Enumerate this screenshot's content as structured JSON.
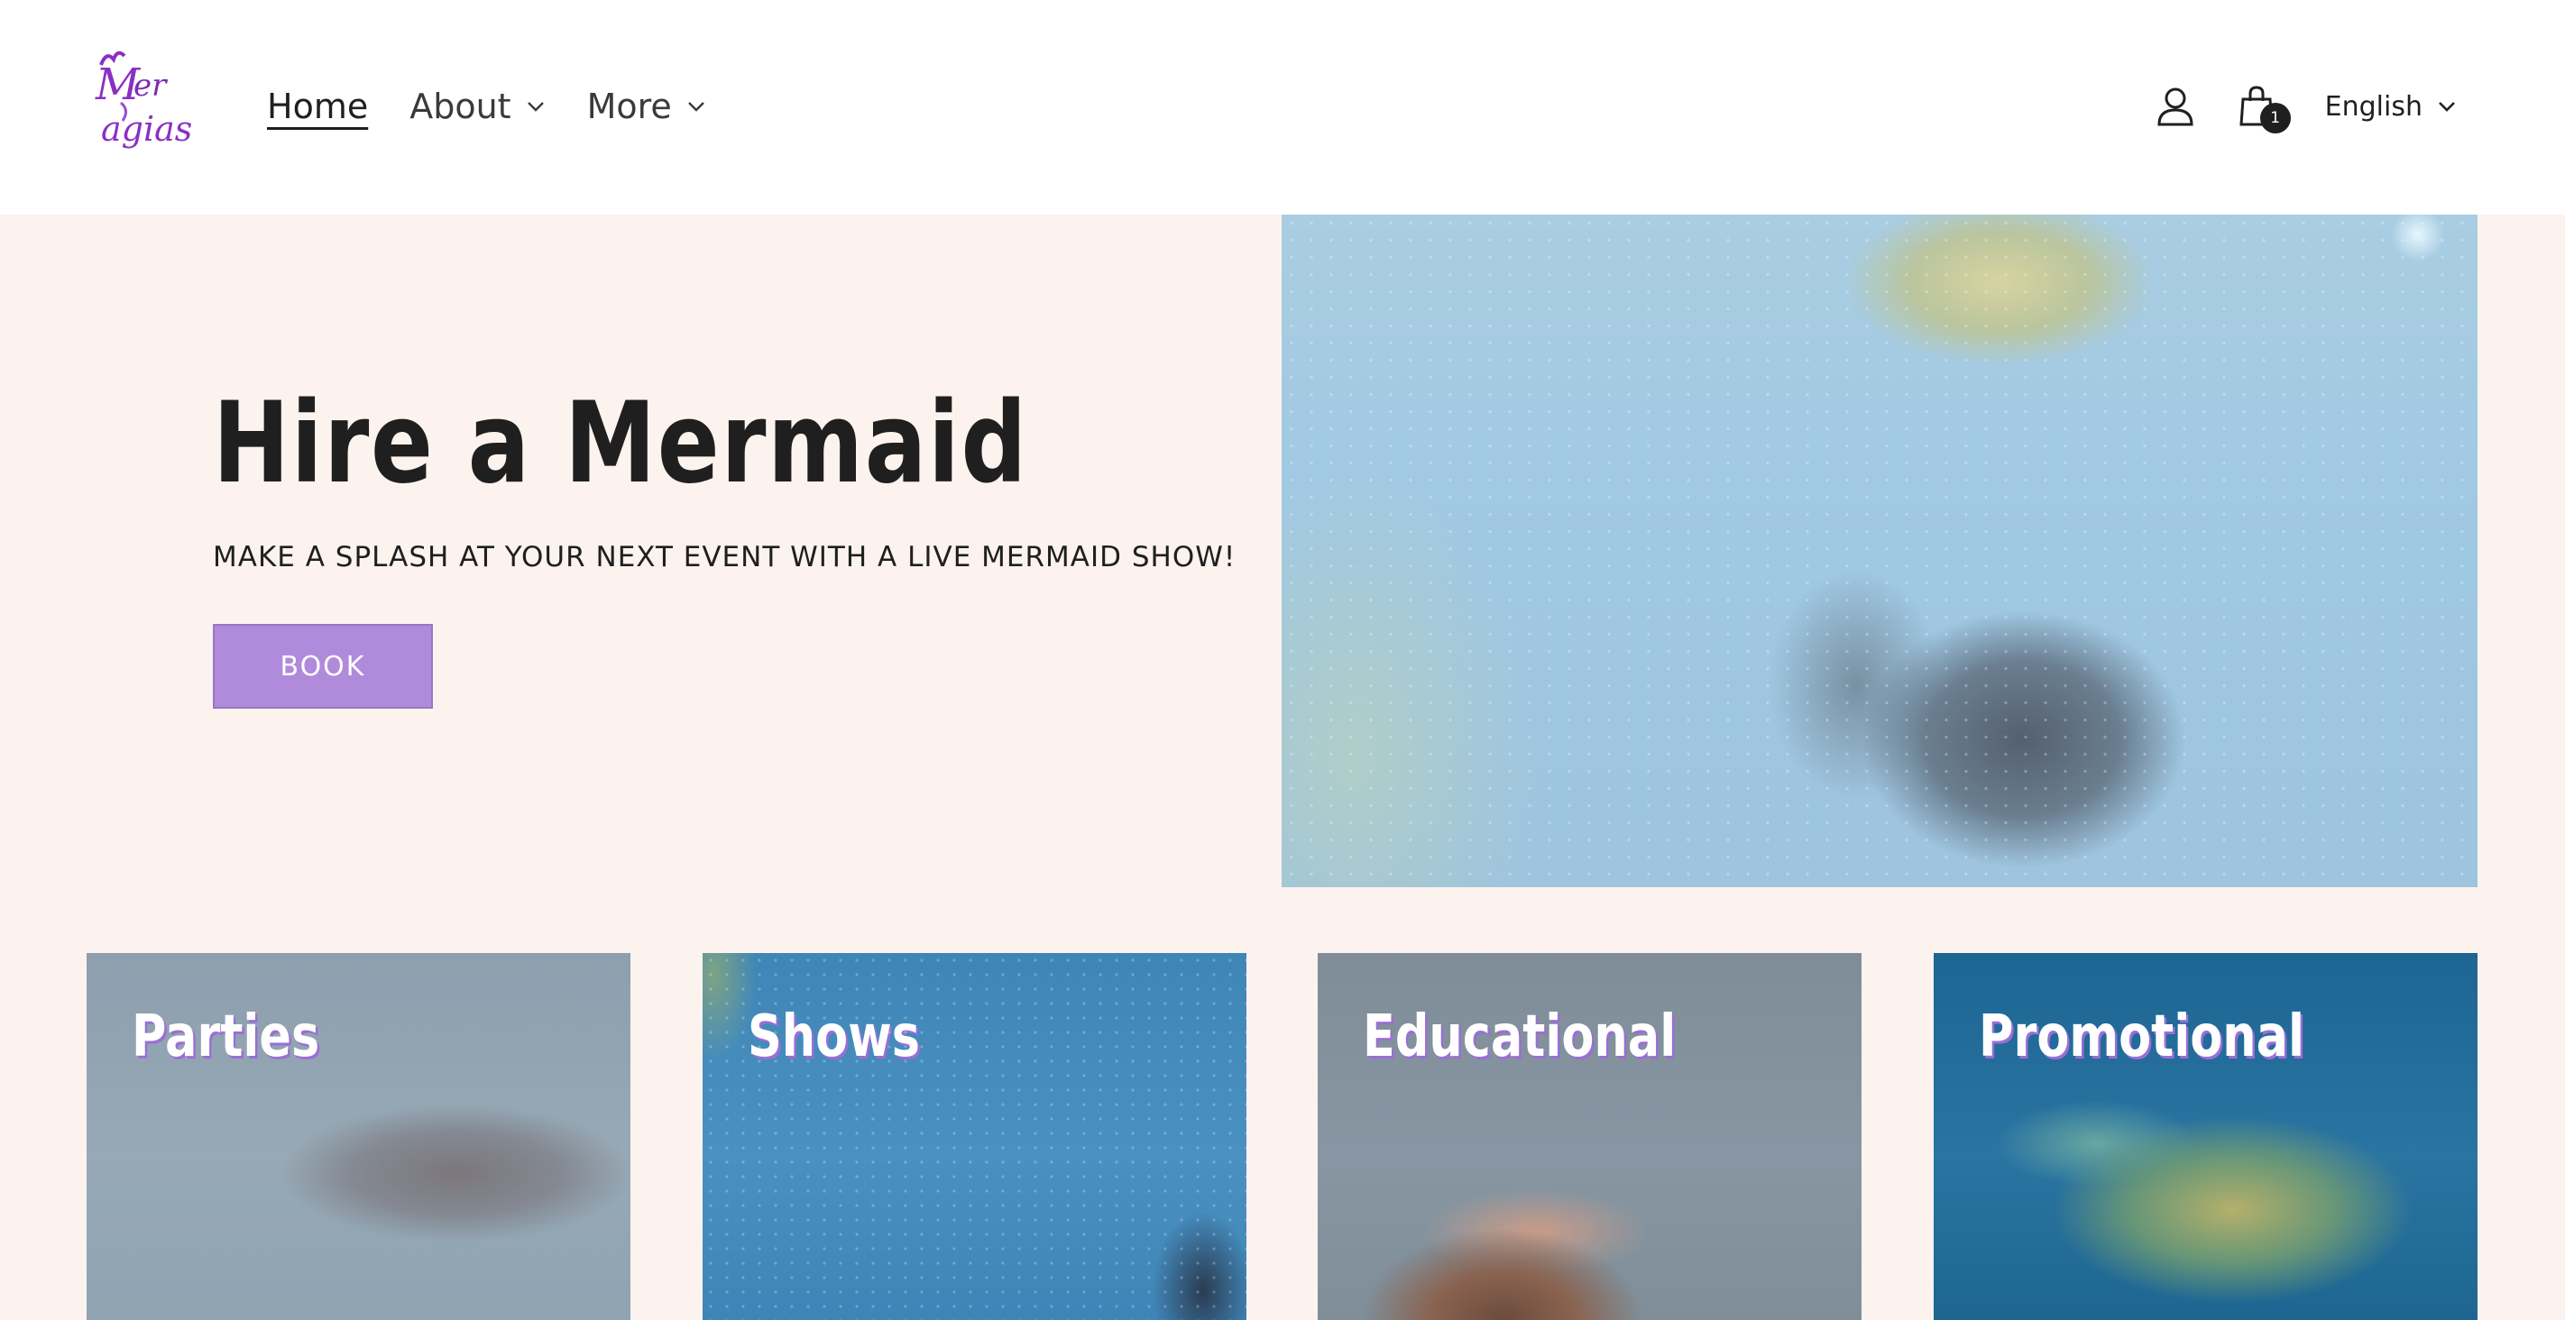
{
  "logo": {
    "alt": "Mer agias"
  },
  "nav": {
    "home_label": "Home",
    "about_label": "About",
    "more_label": "More"
  },
  "header": {
    "cart_count": "1",
    "language": "English"
  },
  "hero": {
    "title": "Hire a Mermaid",
    "subtitle": "MAKE A SPLASH AT YOUR NEXT EVENT WITH A LIVE MERMAID SHOW!",
    "button_label": "BOOK"
  },
  "categories": [
    {
      "title": "Parties"
    },
    {
      "title": "Shows"
    },
    {
      "title": "Educational"
    },
    {
      "title": "Promotional"
    }
  ],
  "colors": {
    "page_background": "#fcf3ee",
    "header_background": "#ffffff",
    "button_accent": "#b08bdb",
    "card_title_shadow": "#9b6ed6",
    "logo_purple": "#8a2fc4"
  },
  "icons": {
    "account": "user-icon",
    "cart": "shopping-bag-icon",
    "dropdown": "chevron-down-icon"
  }
}
